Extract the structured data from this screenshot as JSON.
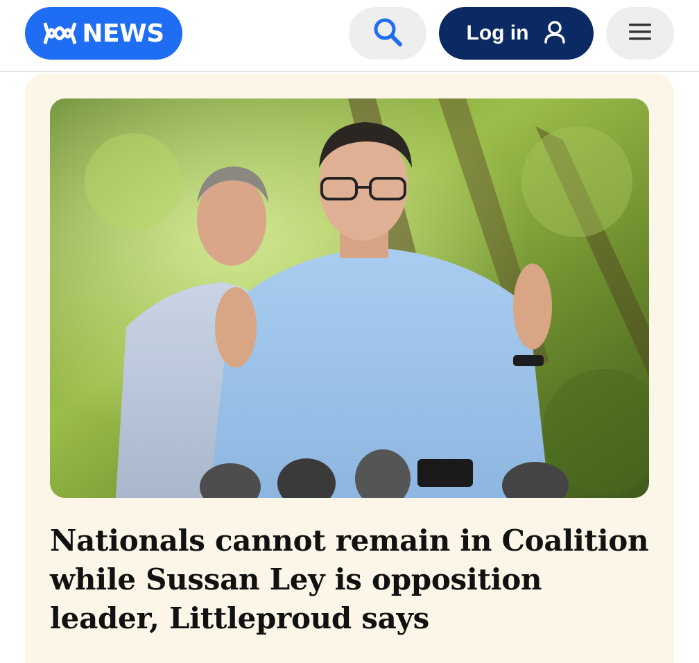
{
  "header": {
    "logo_text": "NEWS",
    "login_label": "Log in",
    "icons": {
      "logo": "abc-logo-icon",
      "search": "search-icon",
      "user": "user-icon",
      "menu": "hamburger-menu-icon"
    }
  },
  "article": {
    "headline": "Nationals cannot remain in Coalition while Sussan Ley is opposition leader, Littleproud says"
  },
  "colors": {
    "brand_blue": "#1f6df3",
    "login_navy": "#0b2a63",
    "card_bg": "#fcf6e9"
  }
}
